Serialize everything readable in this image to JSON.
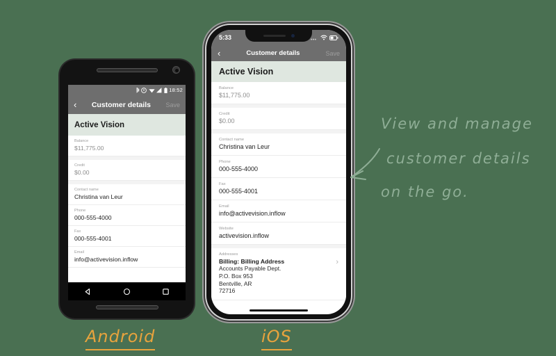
{
  "page": {
    "background_color": "#4a7052",
    "accent_handwriting_color": "#8fae96",
    "accent_label_color": "#e8a33d"
  },
  "annotation": {
    "line1": "View and manage",
    "line2": "customer details",
    "line3": "on the go.",
    "arrow": "curved-arrow-pointing-left"
  },
  "platform_labels": {
    "android": "Android",
    "ios": "iOS"
  },
  "android": {
    "status_bar": {
      "time": "18:52",
      "icons": [
        "bluetooth-icon",
        "alert-icon",
        "wifi-icon",
        "signal-icon",
        "battery-icon"
      ]
    },
    "app_bar": {
      "back_icon": "chevron-left-icon",
      "title": "Customer details",
      "save_label": "Save"
    },
    "customer_name": "Active Vision",
    "fields": [
      {
        "label": "Balance",
        "value": "$11,775.00",
        "muted": true
      },
      {
        "label": "Credit",
        "value": "$0.00",
        "muted": true
      },
      {
        "label": "Contact name",
        "value": "Christina van Leur",
        "muted": false
      },
      {
        "label": "Phone",
        "value": "000-555-4000",
        "muted": false
      },
      {
        "label": "Fax",
        "value": "000-555-4001",
        "muted": false
      },
      {
        "label": "Email",
        "value": "info@activevision.inflow",
        "muted": false
      }
    ],
    "nav_bar": {
      "back": "back-triangle-icon",
      "home": "home-circle-icon",
      "recents": "recents-square-icon"
    }
  },
  "ios": {
    "status_bar": {
      "time": "5:33",
      "icons": [
        "signal-dots-icon",
        "wifi-icon",
        "battery-icon"
      ]
    },
    "app_bar": {
      "back_icon": "chevron-left-icon",
      "title": "Customer details",
      "save_label": "Save"
    },
    "customer_name": "Active Vision",
    "fields": [
      {
        "label": "Balance",
        "value": "$11,775.00",
        "muted": true
      },
      {
        "label": "Credit",
        "value": "$0.00",
        "muted": true
      },
      {
        "label": "Contact name",
        "value": "Christina van Leur",
        "muted": false
      },
      {
        "label": "Phone",
        "value": "000-555-4000",
        "muted": false
      },
      {
        "label": "Fax",
        "value": "000-555-4001",
        "muted": false
      },
      {
        "label": "Email",
        "value": "info@activevision.inflow",
        "muted": false
      },
      {
        "label": "Website",
        "value": "activevision.inflow",
        "muted": false
      }
    ],
    "addresses": {
      "label": "Addresses",
      "title": "Billing: Billing Address",
      "lines": [
        "Accounts Payable Dept.",
        "P.O. Box 953",
        "Bentville, AR",
        "72716"
      ],
      "chevron": "chevron-right-icon"
    }
  }
}
